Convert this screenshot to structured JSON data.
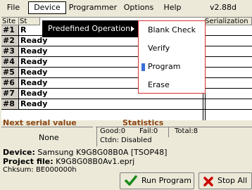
{
  "menubar": {
    "file": "File",
    "device": "Device",
    "programmer": "Programmer",
    "options": "Options",
    "help": "Help",
    "version": "v2.88d"
  },
  "table": {
    "headers": {
      "site": "Site",
      "status": "St",
      "serialization": "Serialization"
    },
    "rows": [
      {
        "site": "#1",
        "status": "R"
      },
      {
        "site": "#2",
        "status": "Ready"
      },
      {
        "site": "#3",
        "status": "Ready"
      },
      {
        "site": "#4",
        "status": "Ready"
      },
      {
        "site": "#5",
        "status": "Ready"
      },
      {
        "site": "#6",
        "status": "Ready"
      },
      {
        "site": "#7",
        "status": "Ready"
      },
      {
        "site": "#8",
        "status": "Ready"
      }
    ]
  },
  "device_menu": {
    "item": "Predefined Operation"
  },
  "operation_menu": {
    "items": [
      "Blank Check",
      "Verify",
      "Program",
      "Erase"
    ]
  },
  "next_serial": {
    "title": "Next serial value",
    "value": "None"
  },
  "statistics": {
    "title": "Statistics",
    "good": "Good:0",
    "fail": "Fail:0",
    "total": "Total:8",
    "ctdn": "Ctdn: Disabled"
  },
  "info": {
    "device_label": "Device:",
    "device_value": "Samsung K9G8G08B0A [TSOP48]",
    "project_label": "Project file:",
    "project_value": "K9G8G08B0Av1.eprj",
    "checksum": "Chksum: BE000000h"
  },
  "buttons": {
    "run": "Run Program",
    "stop": "Stop All"
  },
  "colors": {
    "panel_title": "#8b4513",
    "menu_border": "#d83030",
    "run_icon": "#1a8a1a",
    "stop_icon": "#cc0000"
  }
}
